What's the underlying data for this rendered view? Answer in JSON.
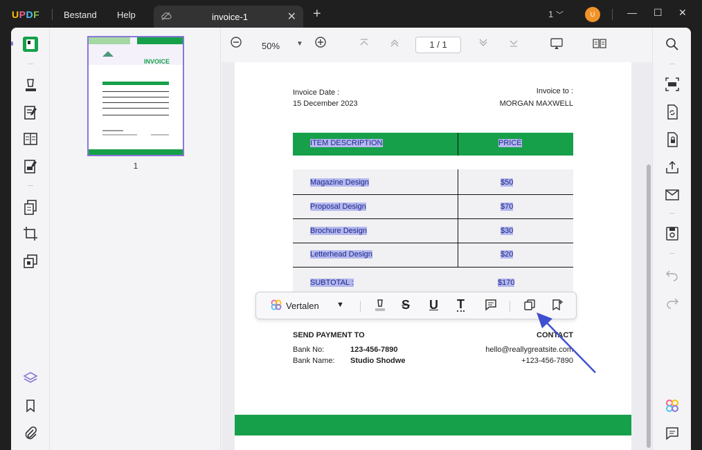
{
  "titlebar": {
    "logo": "UPDF",
    "menus": [
      "Bestand",
      "Help"
    ],
    "tab_title": "invoice-1",
    "page_count": "1",
    "avatar_initial": "U"
  },
  "toolbar": {
    "zoom": "50%",
    "page_current": "1",
    "page_sep": "/",
    "page_total": "1"
  },
  "thumbnail": {
    "page_label": "1",
    "title": "INVOICE"
  },
  "invoice": {
    "date_label": "Invoice Date :",
    "date_value": "15 December 2023",
    "to_label": "Invoice to :",
    "to_value": "MORGAN MAXWELL",
    "header_desc": "ITEM DESCRIPTION",
    "header_price": "PRICE",
    "items": [
      {
        "desc": "Magazine Design",
        "price": "$50"
      },
      {
        "desc": "Proposal Design",
        "price": "$70"
      },
      {
        "desc": "Brochure Design",
        "price": "$30"
      },
      {
        "desc": "Letterhead Design",
        "price": "$20"
      }
    ],
    "subtotal_label": "SUBTOTAL :",
    "subtotal_value": "$170",
    "payment_heading": "SEND PAYMENT TO",
    "bank_no_label": "Bank No:",
    "bank_no_value": "123-456-7890",
    "bank_name_label": "Bank Name:",
    "bank_name_value": "Studio Shodwe",
    "contact_heading": "CONTACT",
    "contact_email": "hello@reallygreatsite.com",
    "contact_phone": "+123-456-7890"
  },
  "float_toolbar": {
    "translate_label": "Vertalen"
  },
  "colors": {
    "green": "#16a04a",
    "selection": "#b5b7ee",
    "accent": "#8a75d8",
    "arrow": "#3f4fd0"
  }
}
